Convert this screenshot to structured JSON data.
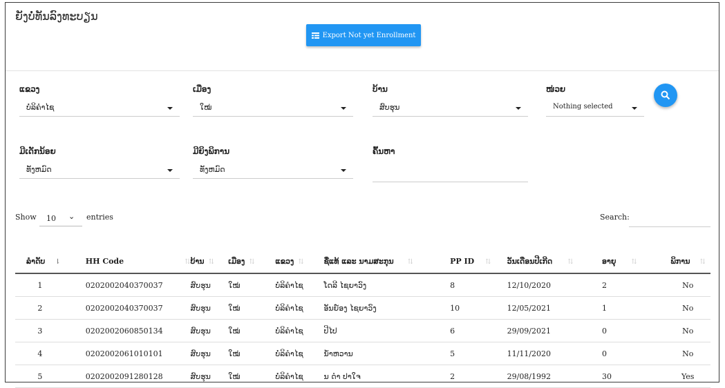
{
  "page": {
    "title": "ຍັງບໍ່ທັນລົງທະບຽນ",
    "export_button": "Export Not yet Enrollment"
  },
  "filters": {
    "province": {
      "label": "ແຂວງ",
      "value": "ບໍ່ລິຄຳໄຊ"
    },
    "district": {
      "label": "ເມືອງ",
      "value": "ໃໝ່"
    },
    "village": {
      "label": "ບ້ານ",
      "value": "ສົບຮຸນ"
    },
    "unit": {
      "label": "ໜ່ວຍ",
      "value": "Nothing selected"
    },
    "has_children": {
      "label": "ມີເດັກນ້ອຍ",
      "value": "ທັງຫມົດ"
    },
    "has_disability": {
      "label": "ມີຍິງພິການ",
      "value": "ທັງຫມົດ"
    },
    "search": {
      "label": "ຄົ້ນຫາ"
    }
  },
  "table_controls": {
    "show_label": "Show",
    "page_length": "10",
    "entries_label": "entries",
    "search_label": "Search:"
  },
  "table": {
    "columns": [
      "ລຳດັບ",
      "HH Code",
      "ບ້ານ",
      "ເມືອງ",
      "ແຂວງ",
      "ຊື່ແທ້ ແລະ ນາມສະກຸນ",
      "PP ID",
      "ວັນເດືອນປີເກີດ",
      "ອາຍຸ",
      "ພິການ"
    ],
    "rows": [
      [
        "1",
        "0202002040370037",
        "ສົບຮຸນ",
        "ໃໝ່",
        "ບໍ່ລິຄຳໄຊ",
        "ໂດລີ ໄຊຍາວົງ",
        "8",
        "12/10/2020",
        "2",
        "No"
      ],
      [
        "2",
        "0202002040370037",
        "ສົບຮຸນ",
        "ໃໝ່",
        "ບໍ່ລິຄຳໄຊ",
        "ອັນຍ໌ອງ ໄຊຍາວົງ",
        "10",
        "12/05/2021",
        "1",
        "No"
      ],
      [
        "3",
        "0202002060850134",
        "ສົບຮຸນ",
        "ໃໝ່",
        "ບໍ່ລິຄຳໄຊ",
        "ປີໄປ",
        "6",
        "29/09/2021",
        "0",
        "No"
      ],
      [
        "4",
        "0202002061010101",
        "ສົບຮຸນ",
        "ໃໝ່",
        "ບໍ່ລິຄຳໄຊ",
        "ນ້ຳຫວານ",
        "5",
        "11/11/2020",
        "0",
        "No"
      ],
      [
        "5",
        "0202002091280128",
        "ສົບຮຸນ",
        "ໃໝ່",
        "ບໍ່ລິຄຳໄຊ",
        "ນ ດຳ ປາໃຈ",
        "2",
        "29/08/1992",
        "30",
        "Yes"
      ]
    ]
  },
  "colors": {
    "accent": "#2196f3"
  },
  "icons": {
    "export": "table-icon",
    "search": "search-icon",
    "sort": "sort-icon"
  }
}
